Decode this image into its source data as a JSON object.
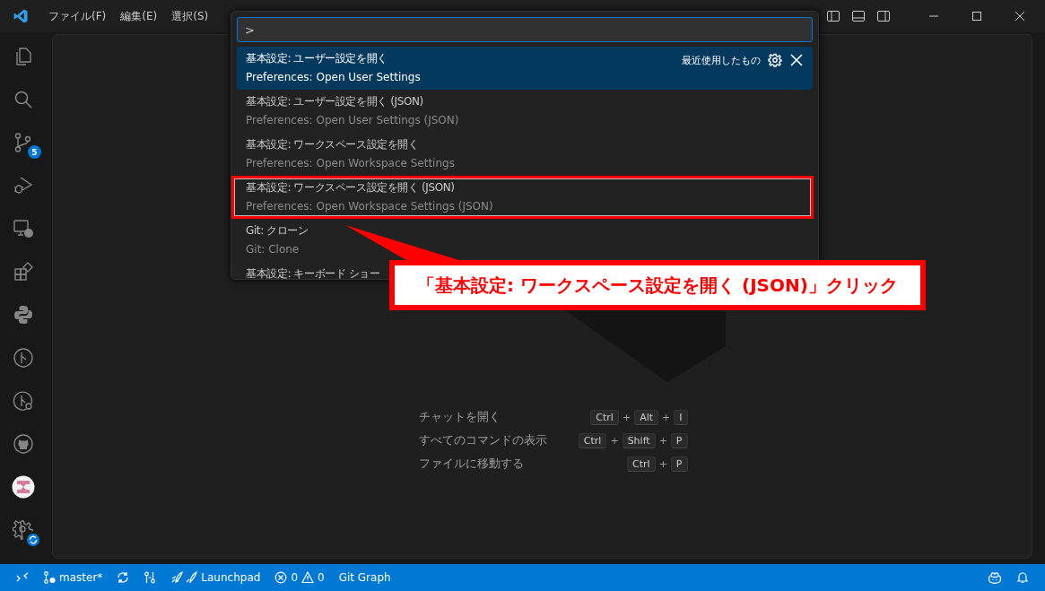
{
  "window": {
    "menus": [
      "ファイル(F)",
      "編集(E)",
      "選択(S)"
    ]
  },
  "activity_bar": {
    "scm_badge": "5"
  },
  "command_palette": {
    "value": ">",
    "recent_label": "最近使用したもの",
    "items": [
      {
        "label": "基本設定: ユーザー設定を開く",
        "detail": "Preferences: Open User Settings",
        "selected": true,
        "annotated": false
      },
      {
        "label": "基本設定: ユーザー設定を開く (JSON)",
        "detail": "Preferences: Open User Settings (JSON)",
        "selected": false,
        "annotated": false
      },
      {
        "label": "基本設定: ワークスペース設定を開く",
        "detail": "Preferences: Open Workspace Settings",
        "selected": false,
        "annotated": false
      },
      {
        "label": "基本設定: ワークスペース設定を開く (JSON)",
        "detail": "Preferences: Open Workspace Settings (JSON)",
        "selected": false,
        "annotated": true
      },
      {
        "label": "Git: クローン",
        "detail": "Git: Clone",
        "selected": false,
        "annotated": false
      },
      {
        "label": "基本設定: キーボード ショー",
        "selected": false,
        "annotated": false
      }
    ]
  },
  "annotation": {
    "text": "「基本設定: ワークスペース設定を開く (JSON)」クリック"
  },
  "shortcuts": {
    "separator": "+",
    "rows": [
      {
        "label": "チャットを開く",
        "keys": [
          "Ctrl",
          "Alt",
          "I"
        ]
      },
      {
        "label": "すべてのコマンドの表示",
        "keys": [
          "Ctrl",
          "Shift",
          "P"
        ]
      },
      {
        "label": "ファイルに移動する",
        "keys": [
          "Ctrl",
          "P"
        ]
      }
    ]
  },
  "status_bar": {
    "branch": "master*",
    "launchpad": "Launchpad",
    "errors": "0",
    "warnings": "0",
    "git_graph": "Git Graph"
  }
}
